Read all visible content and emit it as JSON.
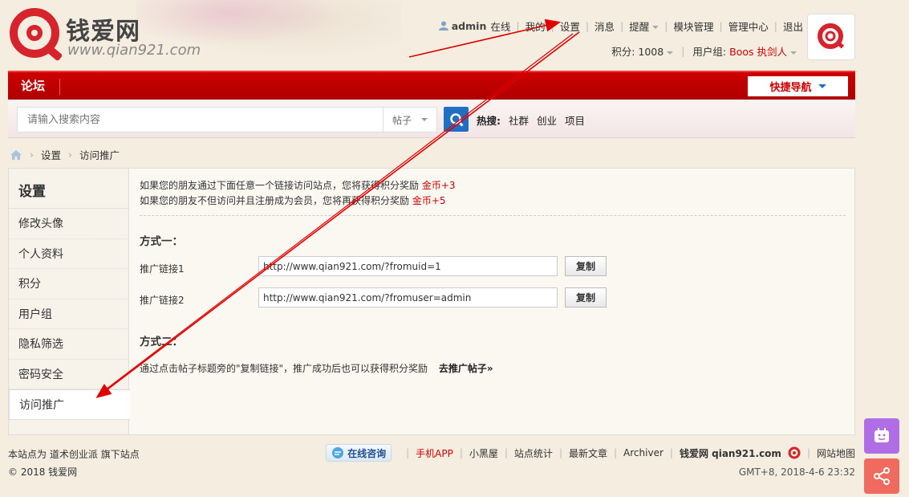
{
  "header": {
    "logo_name": "钱爱网",
    "logo_url": "www.qian921.com",
    "username": "admin",
    "online": "在线",
    "links": [
      "我的",
      "设置",
      "消息",
      "提醒",
      "模块管理",
      "管理中心",
      "退出"
    ],
    "points_label": "积分: 1008",
    "usergroup_label": "用户组:",
    "usergroup_value": "Boos 执剑人"
  },
  "navbar": {
    "forum": "论坛",
    "quick_nav": "快捷导航"
  },
  "search": {
    "placeholder": "请输入搜索内容",
    "type": "帖子",
    "hot_label": "热搜:",
    "hot_items": [
      "社群",
      "创业",
      "项目"
    ]
  },
  "breadcrumb": {
    "items": [
      "设置",
      "访问推广"
    ]
  },
  "sidebar": {
    "title": "设置",
    "items": [
      "修改头像",
      "个人资料",
      "积分",
      "用户组",
      "隐私筛选",
      "密码安全",
      "访问推广"
    ]
  },
  "content": {
    "intro_1": "如果您的朋友通过下面任意一个链接访问站点，您将获得积分奖励 ",
    "intro_1_reward": "金币+3",
    "intro_2": "如果您的朋友不但访问并且注册成为会员，您将再获得积分奖励 ",
    "intro_2_reward": "金币+5",
    "method1_title": "方式一：",
    "link1_label": "推广链接1",
    "link1_value": "http://www.qian921.com/?fromuid=1",
    "link2_label": "推广链接2",
    "link2_value": "http://www.qian921.com/?fromuser=admin",
    "copy_label": "复制",
    "method2_title": "方式二：",
    "method2_text": "通过点击帖子标题旁的\"复制链接\"，推广成功后也可以获得积分奖励",
    "method2_link": "去推广帖子»"
  },
  "footer": {
    "site_prefix": "本站点为",
    "site_org": "道术创业派",
    "site_suffix": "旗下站点",
    "copyright": "© 2018 钱爱网",
    "consult": "在线咨询",
    "links": [
      "手机APP",
      "小黑屋",
      "站点统计",
      "最新文章",
      "Archiver"
    ],
    "brand": "钱爱网 qian921.com",
    "sitemap": "网站地图",
    "time": "GMT+8, 2018-4-6 23:32"
  },
  "colors": {
    "brand_red": "#c00000",
    "accent_blue": "#1f6fc4",
    "annotation_red": "#e00000"
  }
}
